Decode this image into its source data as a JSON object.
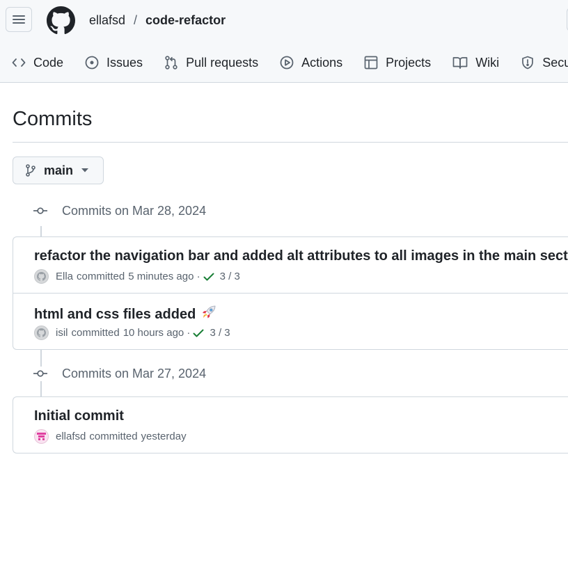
{
  "header": {
    "owner": "ellafsd",
    "separator": "/",
    "repo": "code-refactor"
  },
  "tabs": [
    {
      "label": "Code",
      "icon": "code-icon"
    },
    {
      "label": "Issues",
      "icon": "issue-icon"
    },
    {
      "label": "Pull requests",
      "icon": "pull-request-icon"
    },
    {
      "label": "Actions",
      "icon": "play-icon"
    },
    {
      "label": "Projects",
      "icon": "table-icon"
    },
    {
      "label": "Wiki",
      "icon": "book-icon"
    },
    {
      "label": "Security",
      "icon": "shield-icon"
    }
  ],
  "page": {
    "title": "Commits"
  },
  "branch": {
    "name": "main"
  },
  "groups": [
    {
      "header": "Commits on Mar 28, 2024",
      "commits": [
        {
          "title": "refactor the navigation bar and added alt attributes to all images in the main section",
          "author": "Ella",
          "action": "committed",
          "time": "5 minutes ago",
          "checks": "3 / 3",
          "avatar": "gray"
        },
        {
          "title": "html and css files added",
          "emoji": "rocket-icon",
          "author": "isil",
          "action": "committed",
          "time": "10 hours ago",
          "checks": "3 / 3",
          "avatar": "gray"
        }
      ]
    },
    {
      "header": "Commits on Mar 27, 2024",
      "commits": [
        {
          "title": "Initial commit",
          "author": "ellafsd",
          "action": "committed",
          "time": "yesterday",
          "avatar": "pink"
        }
      ]
    }
  ],
  "colors": {
    "accent_check": "#1a7f37",
    "muted": "#59636e",
    "border": "#d0d7de"
  }
}
